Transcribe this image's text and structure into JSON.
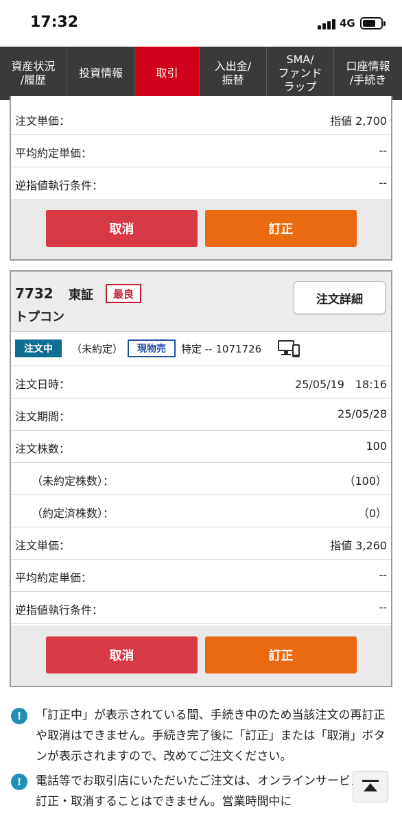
{
  "status_bar": {
    "time": "17:32",
    "network": "4G"
  },
  "nav": {
    "items": [
      {
        "label": "資産状況\n/履歴",
        "active": false
      },
      {
        "label": "投資情報",
        "active": false
      },
      {
        "label": "取引",
        "active": true
      },
      {
        "label": "入出金/\n振替",
        "active": false
      },
      {
        "label": "SMA/\nファンド\nラップ",
        "active": false
      },
      {
        "label": "口座情報\n/手続き",
        "active": false
      }
    ]
  },
  "prev_order": {
    "rows": [
      {
        "label": "注文単価：",
        "value": "指値 2,700"
      },
      {
        "label": "平均約定単価：",
        "value": "--"
      },
      {
        "label": "逆指値執行条件：",
        "value": "--"
      }
    ],
    "cancel_label": "取消",
    "modify_label": "訂正"
  },
  "order": {
    "code": "7732",
    "market": "東証",
    "best_badge": "最良",
    "name": "トプコン",
    "detail_button": "注文詳細",
    "status": "注文中",
    "exec_status": "（未約定）",
    "trade_type": "現物売",
    "account": "特定 -- 1071726",
    "rows": [
      {
        "label": "注文日時：",
        "value": "25/05/19　18:16",
        "indent": false
      },
      {
        "label": "注文期間：",
        "value": "25/05/28",
        "indent": false
      },
      {
        "label": "注文株数：",
        "value": "100",
        "indent": false
      },
      {
        "label": "（未約定株数）：",
        "value": "（100）",
        "indent": true
      },
      {
        "label": "（約定済株数）：",
        "value": "（0）",
        "indent": true
      },
      {
        "label": "注文単価：",
        "value": "指値 3,260",
        "indent": false
      },
      {
        "label": "平均約定単価：",
        "value": "--",
        "indent": false
      },
      {
        "label": "逆指値執行条件：",
        "value": "--",
        "indent": false
      }
    ],
    "cancel_label": "取消",
    "modify_label": "訂正"
  },
  "notes": [
    "「訂正中」が表示されている間、手続き中のため当該注文の再訂正や取消はできません。手続き完了後に「訂正」または「取消」ボタンが表示されますので、改めてご注文ください。",
    "電話等でお取引店にいただいたご注文は、オンラインサービスから訂正・取消することはできません。営業時間中に"
  ],
  "colors": {
    "nav_bg": "#3a3a3a",
    "nav_active": "#d0021b",
    "cancel": "#d83a45",
    "modify": "#e96a10",
    "status_tag": "#0f6e93",
    "type_tag": "#1e4fa3"
  },
  "icons": {
    "device": "pc-mobile-icon",
    "note": "exclamation-circle-icon",
    "to_top": "scroll-to-top-icon"
  }
}
